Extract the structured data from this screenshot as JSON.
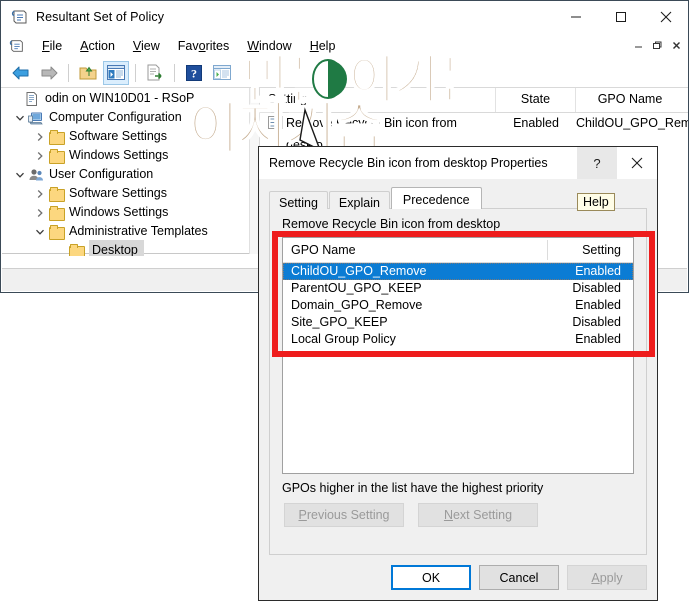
{
  "main_window": {
    "title": "Resultant Set of Policy",
    "title_icon": "policy-scroll-icon",
    "caption_buttons": [
      {
        "name": "minimize",
        "glyph": "—"
      },
      {
        "name": "maximize",
        "glyph": "☐"
      },
      {
        "name": "close",
        "glyph": "✕"
      }
    ],
    "menu": {
      "icon": "policy-scroll-icon",
      "items": [
        {
          "label": "File",
          "accel": "F"
        },
        {
          "label": "Action",
          "accel": "A"
        },
        {
          "label": "View",
          "accel": "V"
        },
        {
          "label": "Favorites",
          "accel": "o"
        },
        {
          "label": "Window",
          "accel": "W"
        },
        {
          "label": "Help",
          "accel": "H"
        }
      ],
      "doc_buttons": [
        "—",
        "❐",
        "✕"
      ]
    },
    "toolbar": [
      {
        "name": "back-icon",
        "tip": "Back"
      },
      {
        "name": "forward-icon",
        "tip": "Forward"
      },
      {
        "name": "up-folder-icon",
        "tip": "Up One Level"
      },
      {
        "name": "show-hide-tree-icon",
        "tip": "Show/Hide Console Tree",
        "selected": true
      },
      {
        "name": "export-list-icon",
        "tip": "Export List"
      },
      {
        "name": "help-icon",
        "tip": "Help"
      },
      {
        "name": "show-pane-icon",
        "tip": "Show/Hide Action Pane"
      }
    ],
    "tree": {
      "root": {
        "label": "odin on WIN10D01 - RSoP",
        "icon": "console-root-icon"
      },
      "nodes": [
        {
          "label": "Computer Configuration",
          "icon": "computer-icon",
          "level": 1,
          "expanded": true,
          "chevron": "down"
        },
        {
          "label": "Software Settings",
          "icon": "folder-icon",
          "level": 2,
          "expanded": false,
          "chevron": "right"
        },
        {
          "label": "Windows Settings",
          "icon": "folder-icon",
          "level": 2,
          "expanded": false,
          "chevron": "right"
        },
        {
          "label": "User Configuration",
          "icon": "user-icon",
          "level": 1,
          "expanded": true,
          "chevron": "down"
        },
        {
          "label": "Software Settings",
          "icon": "folder-icon",
          "level": 2,
          "expanded": false,
          "chevron": "right"
        },
        {
          "label": "Windows Settings",
          "icon": "folder-icon",
          "level": 2,
          "expanded": false,
          "chevron": "right"
        },
        {
          "label": "Administrative Templates",
          "icon": "folder-icon",
          "level": 2,
          "expanded": true,
          "chevron": "down"
        },
        {
          "label": "Desktop",
          "icon": "folder-icon",
          "level": 3,
          "selected": true,
          "chevron": "none"
        }
      ]
    },
    "list_view": {
      "columns": [
        "Setting",
        "State",
        "GPO Name"
      ],
      "rows": [
        {
          "setting": "Remove Recycle Bin icon from desktop",
          "state": "Enabled",
          "gpo_name": "ChildOU_GPO_Remove",
          "icon": "policy-setting-icon"
        }
      ]
    }
  },
  "watermark": {
    "line1": "만들어가는",
    "line2": "이지기즘",
    "color": "#c4ab8e"
  },
  "dialog": {
    "title": "Remove Recycle Bin icon from desktop Properties",
    "caption_buttons": [
      {
        "name": "help",
        "glyph": "?"
      },
      {
        "name": "close",
        "glyph": "✕"
      }
    ],
    "help_tooltip": "Help",
    "tabs": [
      {
        "label": "Setting",
        "active": false
      },
      {
        "label": "Explain",
        "active": false
      },
      {
        "label": "Precedence",
        "active": true
      }
    ],
    "subtitle": "Remove Recycle Bin icon from desktop",
    "gpo_list": {
      "columns": [
        "GPO Name",
        "Setting"
      ],
      "rows": [
        {
          "gpo_name": "ChildOU_GPO_Remove",
          "setting": "Enabled",
          "selected": true
        },
        {
          "gpo_name": "ParentOU_GPO_KEEP",
          "setting": "Disabled",
          "selected": false
        },
        {
          "gpo_name": "Domain_GPO_Remove",
          "setting": "Enabled",
          "selected": false
        },
        {
          "gpo_name": "Site_GPO_KEEP",
          "setting": "Disabled",
          "selected": false
        },
        {
          "gpo_name": "Local Group Policy",
          "setting": "Enabled",
          "selected": false
        }
      ]
    },
    "note": "GPOs higher in the list have the highest priority",
    "nav_buttons": [
      {
        "label_pre": "P",
        "label_post": "revious Setting",
        "disabled": true
      },
      {
        "label_pre": "N",
        "label_post": "ext Setting",
        "disabled": true
      }
    ],
    "action_buttons": [
      {
        "label": "OK",
        "state": "default"
      },
      {
        "label": "Cancel",
        "state": "normal"
      },
      {
        "label": "Apply",
        "state": "disabled",
        "accel": "A"
      }
    ]
  },
  "annotation": {
    "type": "red-rectangle-highlight",
    "color": "#ee1c1c"
  }
}
